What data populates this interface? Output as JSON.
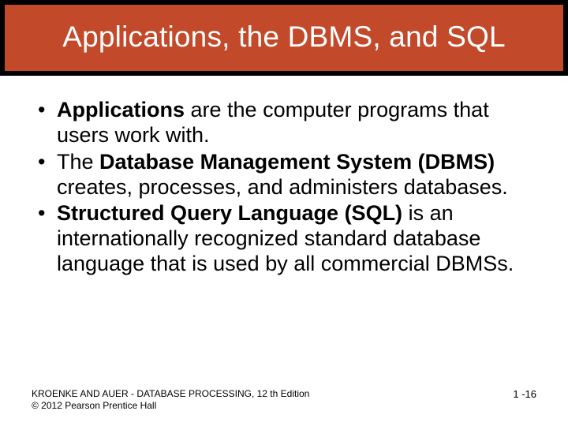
{
  "title": "Applications, the DBMS, and SQL",
  "bullets": [
    {
      "bold": "Applications",
      "rest": " are the computer programs that users work with."
    },
    {
      "pre": "The ",
      "bold": "Database Management System (DBMS)",
      "rest": " creates, processes, and administers databases."
    },
    {
      "bold": "Structured Query Language (SQL)",
      "rest": " is an internationally recognized standard database language that is used by all commercial DBMSs."
    }
  ],
  "footer": {
    "line1": "KROENKE AND AUER - DATABASE PROCESSING, 12 th Edition",
    "line2": "© 2012 Pearson Prentice Hall",
    "page": "1 -16"
  }
}
